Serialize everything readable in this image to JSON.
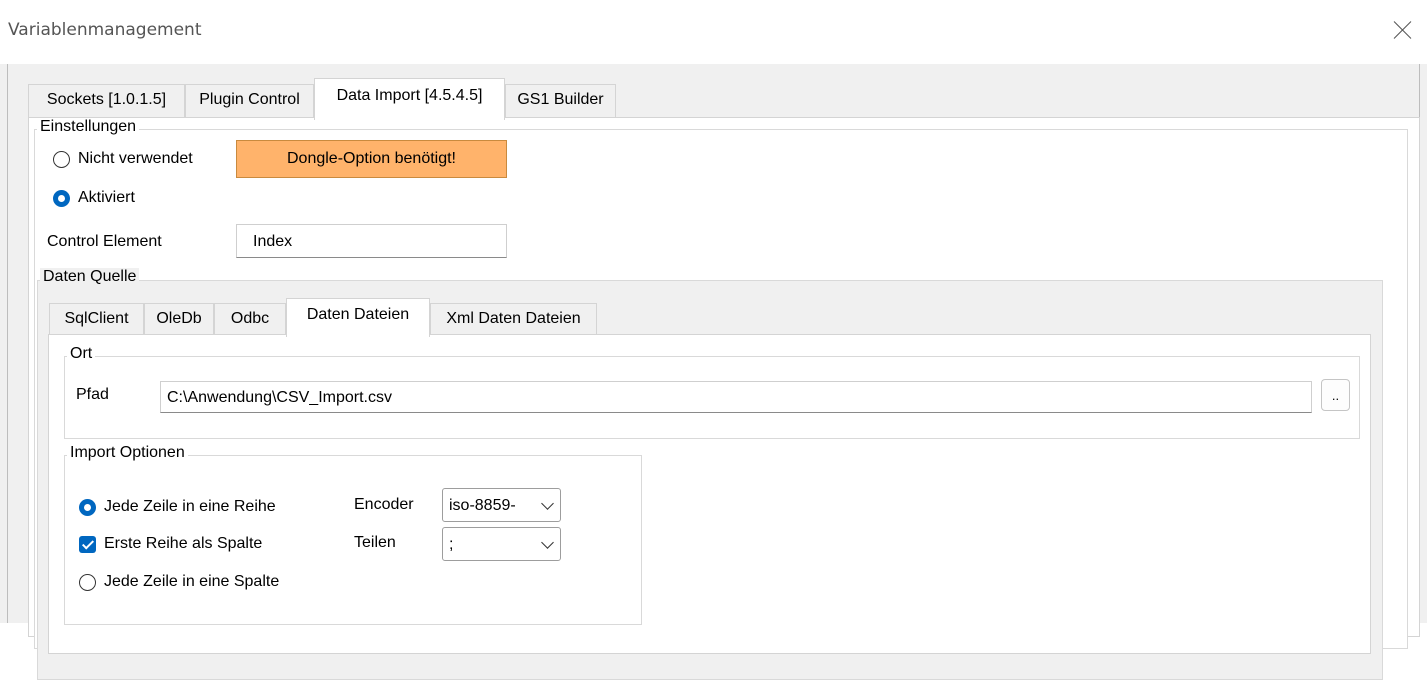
{
  "window": {
    "title": "Variablenmanagement"
  },
  "tabs": [
    "Sockets [1.0.1.5]",
    "Plugin Control",
    "Data Import [4.5.4.5]",
    "GS1 Builder"
  ],
  "settings": {
    "legend": "Einstellungen",
    "radio_not_used": "Nicht verwendet",
    "dongle_button": "Dongle-Option benötigt!",
    "radio_activated": "Aktiviert",
    "selected": "Aktiviert"
  },
  "control_element": {
    "label": "Control Element",
    "value": "Index"
  },
  "datasource": {
    "legend": "Daten Quelle",
    "tabs": [
      "SqlClient",
      "OleDb",
      "Odbc",
      "Daten Dateien",
      "Xml Daten Dateien"
    ],
    "active_tab": "Daten Dateien"
  },
  "location": {
    "legend": "Ort",
    "path_label": "Pfad",
    "path_value": "C:\\Anwendung\\CSV_Import.csv",
    "browse_label": ".."
  },
  "import_options": {
    "legend": "Import Optionen",
    "opt_row": "Jede Zeile in eine Reihe",
    "opt_header": "Erste Reihe als Spalte",
    "opt_column": "Jede Zeile in eine Spalte",
    "opt_row_selected": true,
    "opt_header_checked": true,
    "opt_column_selected": false,
    "encoder_label": "Encoder",
    "encoder_value": "iso-8859-",
    "split_label": "Teilen",
    "split_value": ";"
  }
}
